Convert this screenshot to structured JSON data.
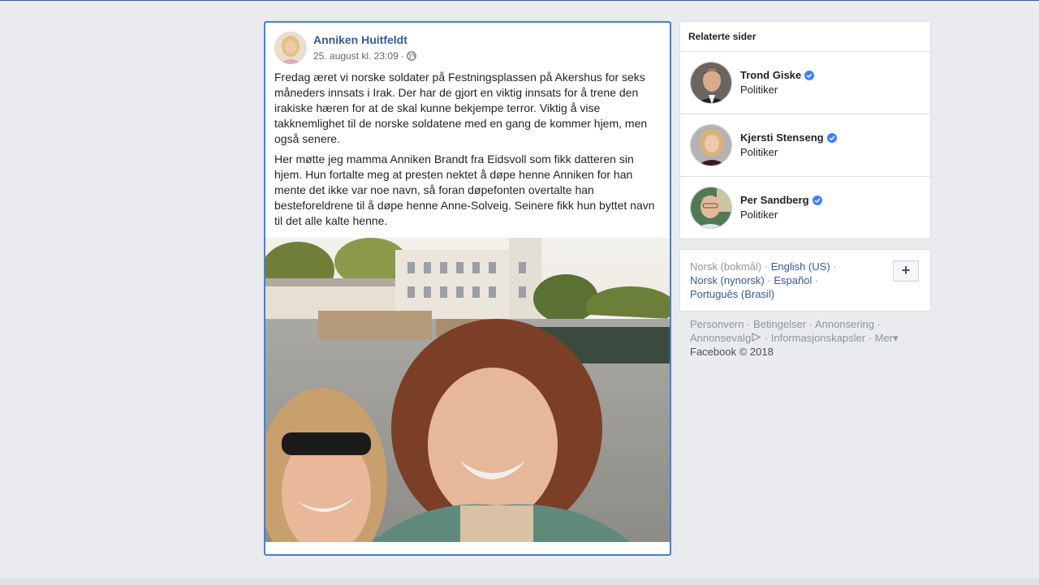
{
  "post": {
    "author": "Anniken Huitfeldt",
    "timestamp": "25. august kl. 23:09",
    "separator": "·",
    "privacy_icon": "globe-icon",
    "paragraphs": [
      "Fredag æret vi norske soldater på Festningsplassen på Akershus for seks måneders innsats i Irak. Der har de gjort en viktig innsats for å trene den irakiske hæren for at de skal kunne bekjempe terror. Viktig å vise takknemlighet til de norske soldatene med en gang de kommer hjem, men også senere.",
      "Her møtte jeg mamma Anniken Brandt fra Eidsvoll som fikk datteren sin hjem. Hun fortalte meg at presten nektet å døpe henne Anniken for han mente det ikke var noe navn, så foran døpefonten overtalte han besteforeldrene til å døpe henne Anne-Solveig. Seinere fikk hun byttet navn til det alle kalte henne."
    ]
  },
  "related": {
    "title": "Relaterte sider",
    "items": [
      {
        "name": "Trond Giske",
        "role": "Politiker"
      },
      {
        "name": "Kjersti Stenseng",
        "role": "Politiker"
      },
      {
        "name": "Per Sandberg",
        "role": "Politiker"
      }
    ]
  },
  "languages": {
    "current": "Norsk (bokmål)",
    "links": [
      "English (US)",
      "Norsk (nynorsk)",
      "Español",
      "Português (Brasil)"
    ],
    "add_label": "+"
  },
  "footer": {
    "links": [
      "Personvern",
      "Betingelser",
      "Annonsering",
      "Annonsevalg",
      "Informasjonskapsler",
      "Mer"
    ],
    "copyright": "Facebook © 2018"
  },
  "colors": {
    "link": "#365899",
    "verified": "#4080ff",
    "post_border": "#4a7ed4",
    "background": "#e9ebee"
  }
}
